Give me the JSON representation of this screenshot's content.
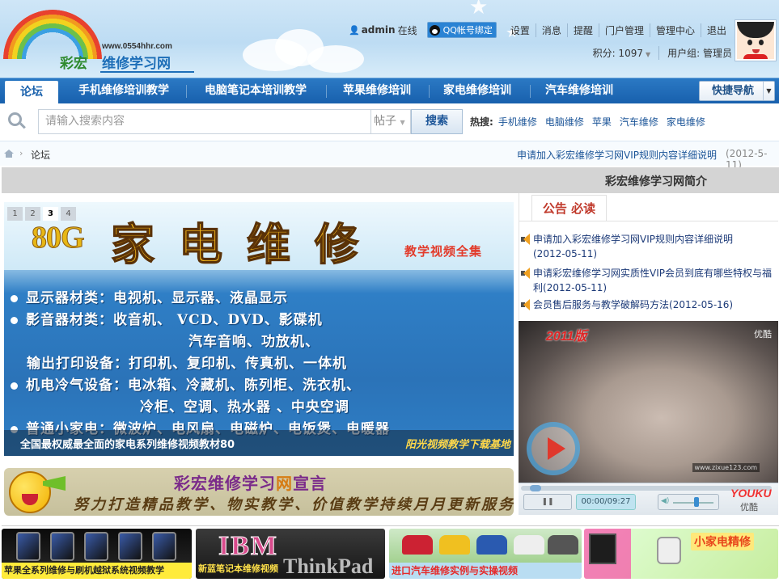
{
  "header": {
    "logo": {
      "domain": "www.0554hhr.com",
      "name_part1": "彩宏",
      "name_part2": "维修学习网"
    },
    "user": {
      "username": "admin",
      "status": "在线",
      "qq_bind": "QQ帐号绑定",
      "links": [
        "设置",
        "消息",
        "提醒",
        "门户管理",
        "管理中心",
        "退出"
      ],
      "credits": "积分: 1097",
      "group": "用户组: 管理员"
    }
  },
  "nav": {
    "tabs": [
      "论坛",
      "手机维修培训教学",
      "电脑笔记本培训教学",
      "苹果维修培训",
      "家电维修培训",
      "汽车维修培训"
    ],
    "active": "论坛",
    "quick_nav": "快捷导航"
  },
  "search": {
    "placeholder": "请输入搜索内容",
    "type": "帖子",
    "button": "搜索",
    "hot_label": "热搜:",
    "hot_words": [
      "手机维修",
      "电脑维修",
      "苹果",
      "汽车维修",
      "家电维修"
    ]
  },
  "breadcrumb": {
    "current": "论坛",
    "notice": "申请加入彩宏维修学习网VIP规则内容详细说明",
    "notice_date": "(2012-5-11)"
  },
  "intro_bar": "彩宏维修学习网简介",
  "slider": {
    "pages": [
      "1",
      "2",
      "3",
      "4"
    ],
    "active_page": "3",
    "image_text": {
      "badge": "80G",
      "title": "家电维修",
      "subtitle": "教学视频全集",
      "lines": [
        "显示器材类：电视机、显示器、液晶显示",
        "影音器材类：收音机、  VCD、DVD、影碟机",
        "汽车音响、功放机、",
        "输出打印设备：打印机、复印机、传真机、一体机",
        "机电冷气设备：电冰箱、冷藏机、陈列柜、洗衣机、",
        "冷柜、空调、热水器  、中央空调",
        "普通小家电：微波炉、电风扇、电磁炉、电饭煲、电暖器"
      ],
      "watermark": "阳光视频教学下载基地"
    },
    "caption": "全国最权威最全面的家电系列维修视频教材80"
  },
  "banner": {
    "title_a": "彩宏维修学习",
    "title_b": "网",
    "title_c": "宣言",
    "slogan": "努力打造精品教学、物实教学、价值教学持续月月更新服务!"
  },
  "notice_panel": {
    "tab": "公告 必读",
    "items": [
      {
        "text": "申请加入彩宏维修学习网VIP规则内容详细说明",
        "date": "(2012-05-11)"
      },
      {
        "text": "申请彩宏维修学习网实质性VIP会员到底有哪些特权与福利",
        "date": "(2012-05-11)"
      },
      {
        "text": "会员售后服务与教学破解码方法",
        "date": "(2012-05-16)"
      }
    ]
  },
  "video": {
    "overlay_version": "2011版",
    "overlay_brand": "优酷",
    "overlay_url": "www.zixue123.com",
    "time": "00:00/09:27",
    "player_logo": "YOUKU",
    "player_logo_cn": "优酷"
  },
  "ads": [
    {
      "caption": "苹果全系列维修与刷机越狱系统视频教学"
    },
    {
      "caption": "新蓝笔记本维修视频",
      "logo_a": "IBM",
      "logo_b": "ThinkPad"
    },
    {
      "caption": "进口汽车维修实例与实操视频"
    },
    {
      "caption": "小家电精修"
    }
  ],
  "colors": {
    "nav_blue": "#1c63ad",
    "link_blue": "#1c5598",
    "notice_red": "#c0392b"
  }
}
